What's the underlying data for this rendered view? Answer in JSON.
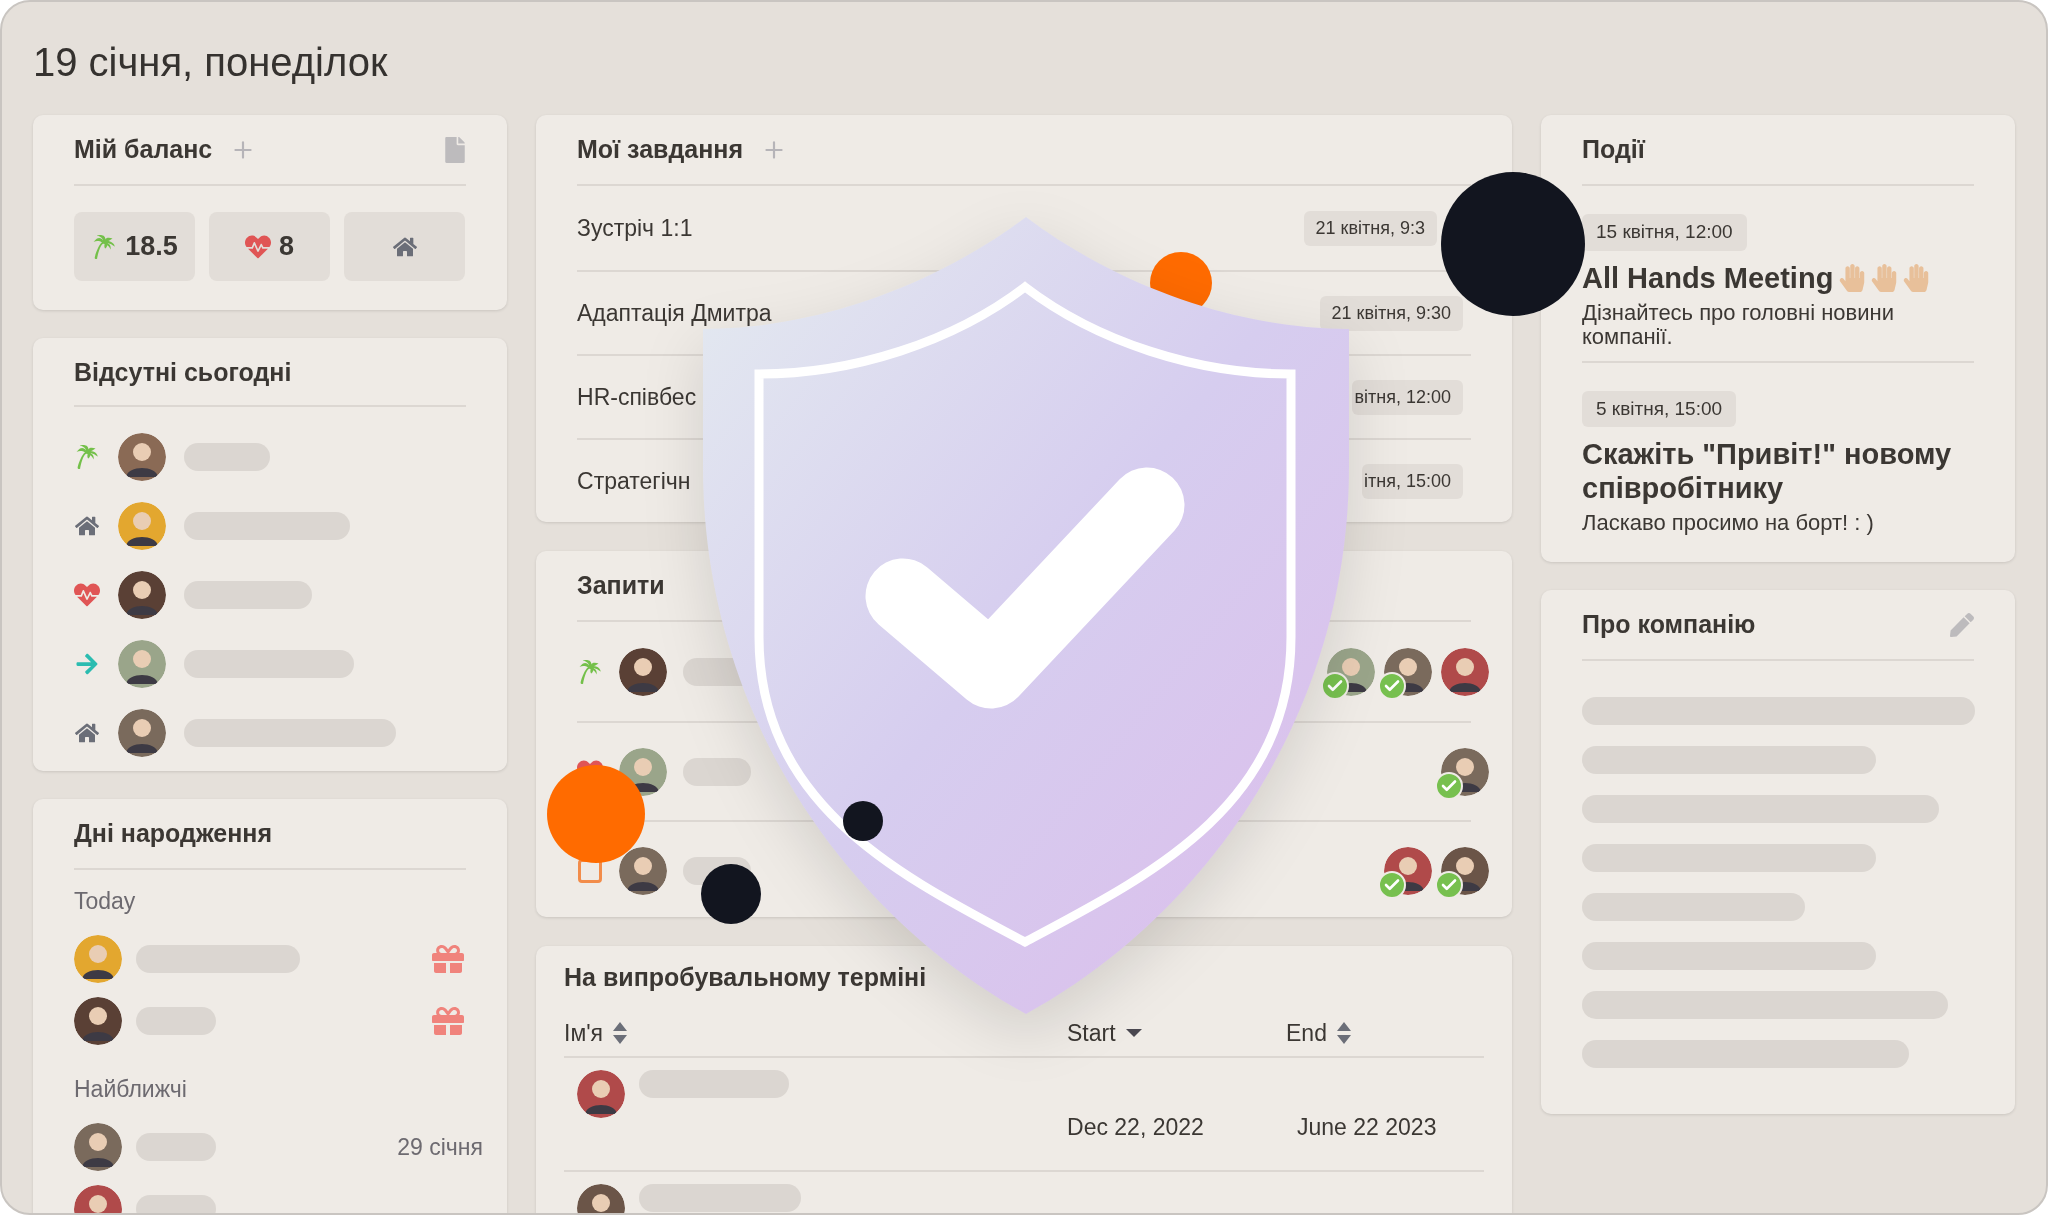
{
  "page_title": "19 січня, понеділок",
  "balance": {
    "title": "Мій баланс",
    "items": [
      {
        "kind": "vacation",
        "value": "18.5"
      },
      {
        "kind": "sick",
        "value": "8"
      },
      {
        "kind": "remote"
      }
    ]
  },
  "absent_today": {
    "title": "Відсутні сьогодні",
    "rows": [
      {
        "kind": "vacation"
      },
      {
        "kind": "remote"
      },
      {
        "kind": "sick"
      },
      {
        "kind": "trip"
      },
      {
        "kind": "remote"
      }
    ]
  },
  "birthdays": {
    "title": "Дні народження",
    "today_label": "Today",
    "today": [
      {
        "kind": "birthday"
      },
      {
        "kind": "birthday"
      }
    ],
    "upcoming_label": "Найближчі",
    "upcoming": [
      {
        "kind": "person",
        "date": "29 січня"
      },
      {
        "kind": "person"
      }
    ]
  },
  "tasks": {
    "title": "Мої завдання",
    "items": [
      {
        "name": "Зустріч 1:1",
        "date": "21 квітня, 9:3"
      },
      {
        "name": "Адаптація Дмитра",
        "date": "21 квітня, 9:30"
      },
      {
        "name": "HR-співбес",
        "date": "вітня, 12:00"
      },
      {
        "name": "Стратегічн",
        "date": "ітня, 15:00"
      }
    ]
  },
  "requests": {
    "title": "Запити",
    "rows": [
      {
        "kind": "vacation",
        "approvers": [
          {
            "approved": true
          },
          {
            "approved": true
          },
          {
            "approved": false
          }
        ]
      },
      {
        "kind": "sick",
        "approvers": [
          {
            "approved": true
          }
        ]
      },
      {
        "kind": "other",
        "approvers": [
          {
            "approved": true
          },
          {
            "approved": true
          }
        ]
      }
    ]
  },
  "probation": {
    "title": "На випробувальному терміні",
    "columns": [
      {
        "label": "Ім'я",
        "kind": "sortable"
      },
      {
        "label": "Start",
        "kind": "sorted-desc"
      },
      {
        "label": "End",
        "kind": "sortable"
      }
    ],
    "rows": [
      {
        "kind": "person",
        "start": "Dec 22, 2022",
        "end": "June 22 2023"
      },
      {
        "kind": "person"
      }
    ]
  },
  "events": {
    "title": "Події",
    "items": [
      {
        "date": "15 квітня, 12:00",
        "title": "All Hands Meeting",
        "kind": "hands",
        "text": "Дізнайтесь про головні новини компанії."
      },
      {
        "date": "5 квітня, 15:00",
        "title": "Скажіть \"Привіт!\" новому співробітнику",
        "kind": "plain",
        "text": "Ласкаво просимо на борт! : )"
      }
    ]
  },
  "about": {
    "title": "Про компанію"
  }
}
